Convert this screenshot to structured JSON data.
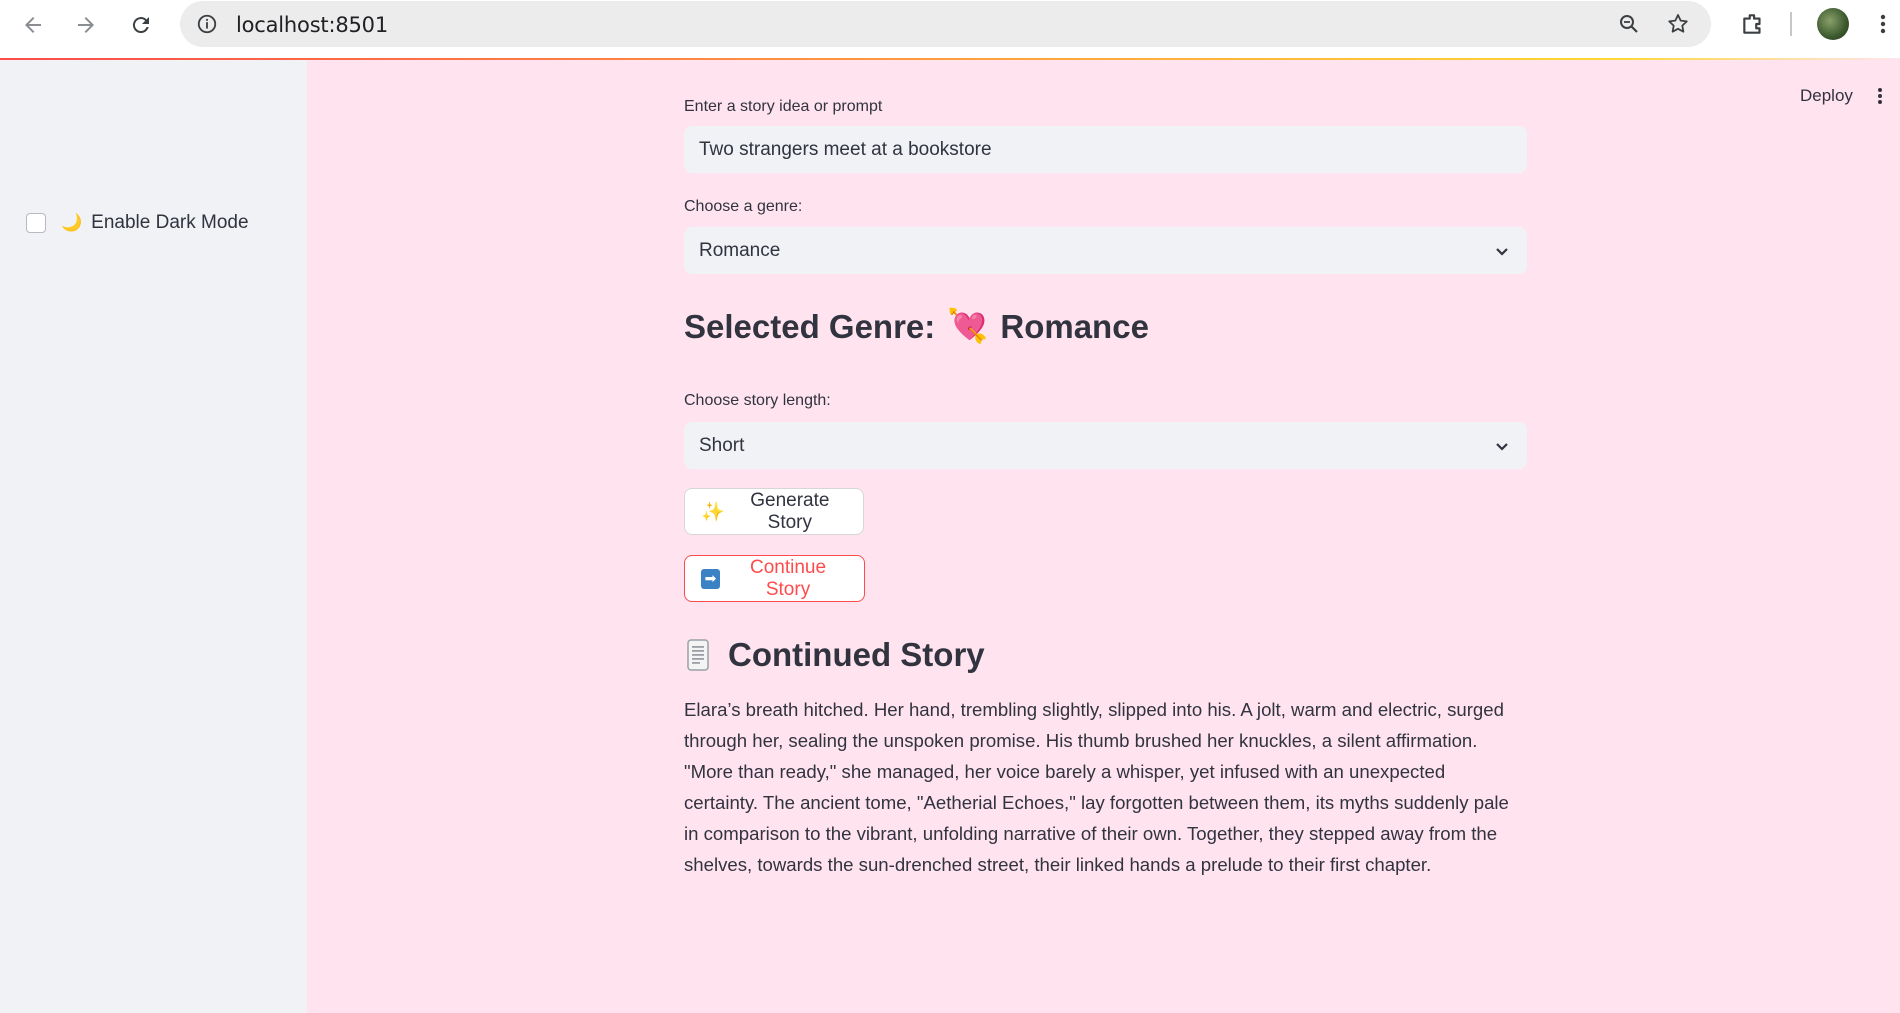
{
  "browser": {
    "url": "localhost:8501"
  },
  "sidebar": {
    "dark_mode_icon": "🌙",
    "dark_mode_label": "Enable Dark Mode",
    "dark_mode_checked": false
  },
  "header": {
    "deploy_label": "Deploy"
  },
  "form": {
    "prompt_label": "Enter a story idea or prompt",
    "prompt_value": "Two strangers meet at a bookstore",
    "genre_label": "Choose a genre:",
    "genre_value": "Romance",
    "selected_genre_prefix": "Selected Genre:",
    "selected_genre_emoji": "💘",
    "selected_genre_name": "Romance",
    "length_label": "Choose story length:",
    "length_value": "Short"
  },
  "buttons": {
    "generate_icon": "✨",
    "generate_label": "Generate Story",
    "continue_icon": "➡",
    "continue_label": "Continue Story"
  },
  "story": {
    "heading": "Continued Story",
    "text": "Elara’s breath hitched. Her hand, trembling slightly, slipped into his. A jolt, warm and electric, surged through her, sealing the unspoken promise. His thumb brushed her knuckles, a silent affirmation. \"More than ready,\" she managed, her voice barely a whisper, yet infused with an unexpected certainty. The ancient tome, \"Aetherial Echoes,\" lay forgotten between them, its myths suddenly pale in comparison to the vibrant, unfolding narrative of their own. Together, they stepped away from the shelves, towards the sun-drenched street, their linked hands a prelude to their first chapter."
  },
  "colors": {
    "page_bg": "#ffe4f0",
    "sidebar_bg": "#f0f2f6",
    "accent": "#ff4b4b",
    "text": "#31333f"
  }
}
